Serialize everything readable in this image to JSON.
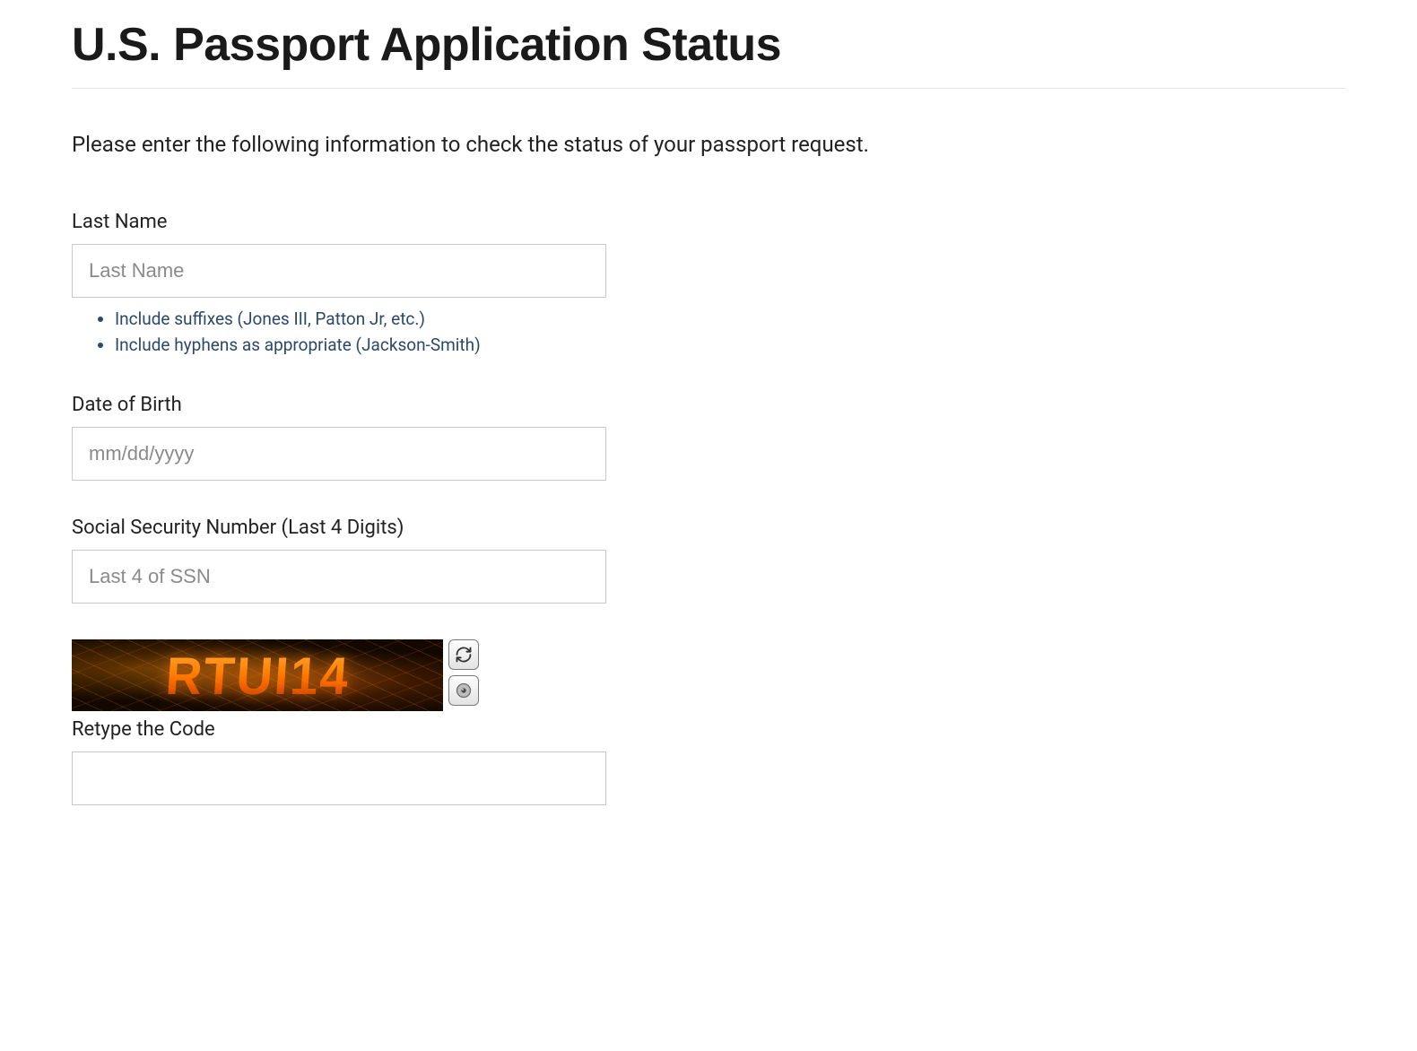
{
  "page": {
    "title": "U.S. Passport Application Status",
    "intro": "Please enter the following information to check the status of your passport request."
  },
  "form": {
    "lastName": {
      "label": "Last Name",
      "placeholder": "Last Name",
      "value": "",
      "hints": [
        "Include suffixes (Jones III, Patton Jr, etc.)",
        "Include hyphens as appropriate (Jackson-Smith)"
      ]
    },
    "dob": {
      "label": "Date of Birth",
      "placeholder": "mm/dd/yyyy",
      "value": ""
    },
    "ssn": {
      "label": "Social Security Number (Last 4 Digits)",
      "placeholder": "Last 4 of SSN",
      "value": ""
    },
    "captcha": {
      "code_shown": "RTUI14",
      "label": "Retype the Code",
      "value": "",
      "refresh_icon": "refresh-icon",
      "audio_icon": "audio-icon"
    }
  }
}
